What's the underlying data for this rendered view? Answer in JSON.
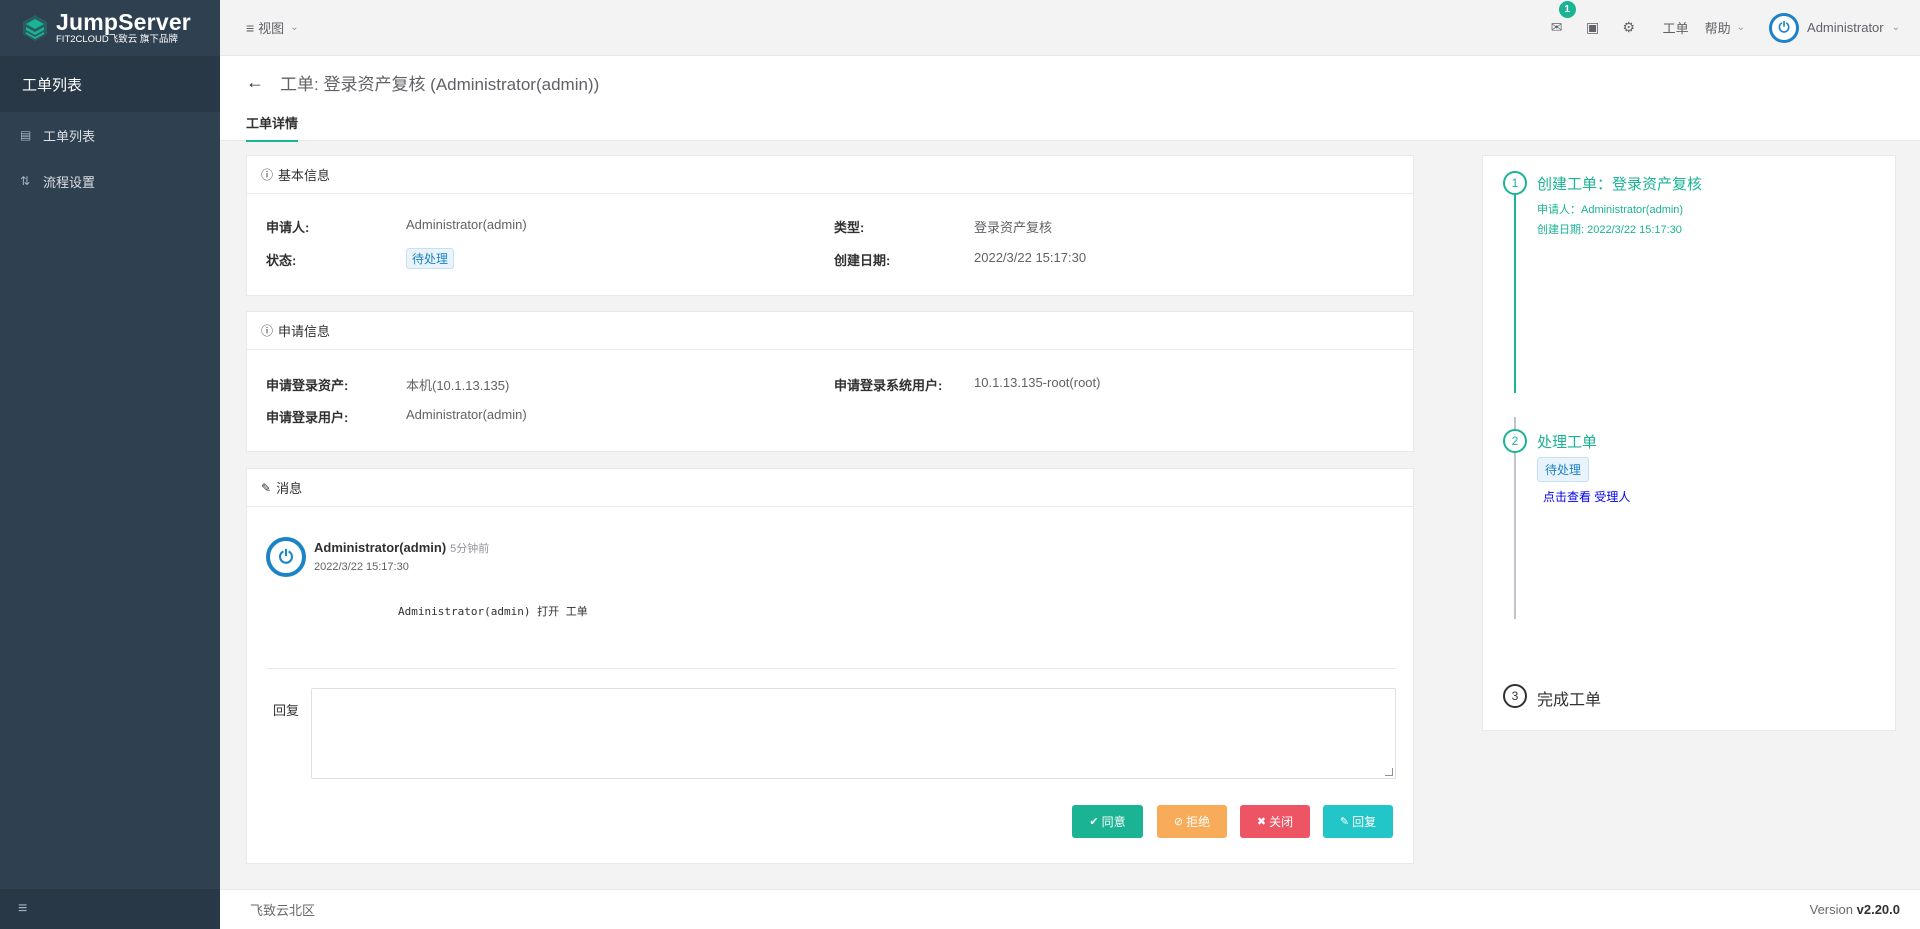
{
  "brand": {
    "name": "JumpServer",
    "sub": "FIT2CLOUD飞致云 旗下品牌"
  },
  "sidebar": {
    "header": "工单列表",
    "items": [
      {
        "label": "工单列表",
        "icon": "file-icon"
      },
      {
        "label": "流程设置",
        "icon": "sort-icon"
      }
    ]
  },
  "topbar": {
    "view_label": "视图",
    "badge_count": "1",
    "ticket_label": "工单",
    "help_label": "帮助",
    "user_label": "Administrator"
  },
  "page": {
    "title": "工单: 登录资产复核 (Administrator(admin))",
    "tab": "工单详情"
  },
  "basic": {
    "header": "基本信息",
    "applicant_label": "申请人:",
    "applicant": "Administrator(admin)",
    "type_label": "类型:",
    "type": "登录资产复核",
    "status_label": "状态:",
    "status": "待处理",
    "created_label": "创建日期:",
    "created": "2022/3/22 15:17:30"
  },
  "apply": {
    "header": "申请信息",
    "asset_label": "申请登录资产:",
    "asset": "本机(10.1.13.135)",
    "sysuser_label": "申请登录系统用户:",
    "sysuser": "10.1.13.135-root(root)",
    "user_label": "申请登录用户:",
    "user": "Administrator(admin)"
  },
  "message": {
    "header": "消息",
    "author": "Administrator(admin)",
    "ago": "5分钟前",
    "date": "2022/3/22 15:17:30",
    "body": "Administrator(admin) 打开 工单",
    "reply_label": "回复",
    "reply_value": "",
    "buttons": {
      "approve": "同意",
      "reject": "拒绝",
      "close": "关闭",
      "reply": "回复"
    }
  },
  "timeline": {
    "step1": {
      "num": "1",
      "title": "创建工单：登录资产复核",
      "applicant": "申请人：Administrator(admin)",
      "date": "创建日期: 2022/3/22 15:17:30"
    },
    "step2": {
      "num": "2",
      "title": "处理工单",
      "status": "待处理",
      "link1": "点击查看",
      "link2": "受理人"
    },
    "step3": {
      "num": "3",
      "title": "完成工单"
    }
  },
  "footer": {
    "left": "飞致云北区",
    "version_prefix": "Version",
    "version": "v2.20.0"
  },
  "colors": {
    "accent": "#1ab394",
    "primary": "#1c84c6",
    "warning": "#f8ac59",
    "danger": "#ed5565",
    "info": "#23c6c8",
    "sidebar": "#2f4050"
  }
}
